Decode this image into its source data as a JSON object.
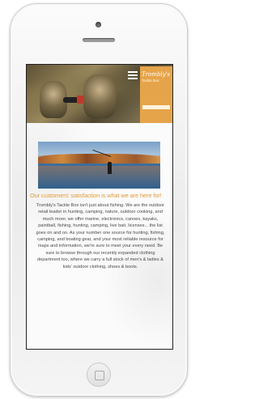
{
  "site": {
    "logo": {
      "title": "Trombly's",
      "subtitle": "Tackle Box"
    }
  },
  "content": {
    "headline": "Our customers' satisfaction is what we are here for!",
    "body": "Trombly's Tackle Box isn't just about fishing. We are the outdoor retail leader in hunting, camping, nature, outdoor cooking, and much more; we offer marine, electronics, canoes, kayaks, paintball, fishing, hunting, camping, live bait, licenses... the list goes on and on. As your number one source for hunting, fishing, camping, and boating gear, and your most reliable resource for maps and information, we're sure to meet your every need. Be sure to browse through our recently expanded clothing department too, where we carry a full stock of men's & ladies & kids' outdoor clothing, shoes & boots."
  },
  "icons": {
    "menu": "hamburger-menu-icon"
  },
  "colors": {
    "accent": "#e6a44a",
    "headline": "#e39a3c",
    "body_text": "#4a4a4a"
  }
}
